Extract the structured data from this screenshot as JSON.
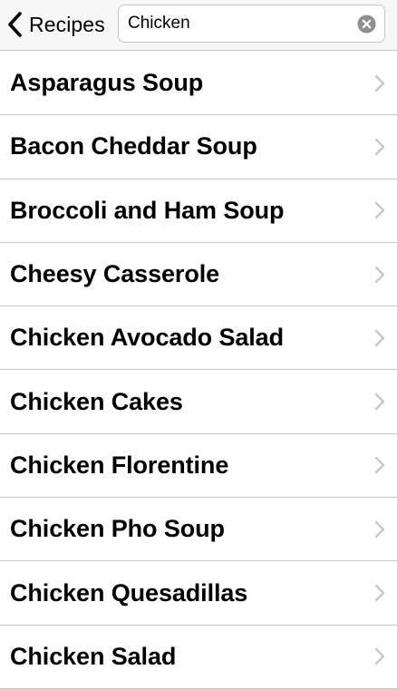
{
  "nav": {
    "back_label": "Recipes",
    "back_icon": "chevron-left-icon"
  },
  "search": {
    "value": "Chicken",
    "clear_icon": "clear-circle-icon"
  },
  "recipes": [
    {
      "label": "Asparagus Soup"
    },
    {
      "label": "Bacon Cheddar Soup"
    },
    {
      "label": "Broccoli and Ham Soup"
    },
    {
      "label": "Cheesy Casserole"
    },
    {
      "label": "Chicken Avocado Salad"
    },
    {
      "label": "Chicken Cakes"
    },
    {
      "label": "Chicken Florentine"
    },
    {
      "label": "Chicken Pho Soup"
    },
    {
      "label": "Chicken Quesadillas"
    },
    {
      "label": "Chicken Salad"
    }
  ],
  "colors": {
    "separator": "#c8c7cc",
    "chevron": "#c7c7cc",
    "nav_background": "#f7f7f7"
  }
}
